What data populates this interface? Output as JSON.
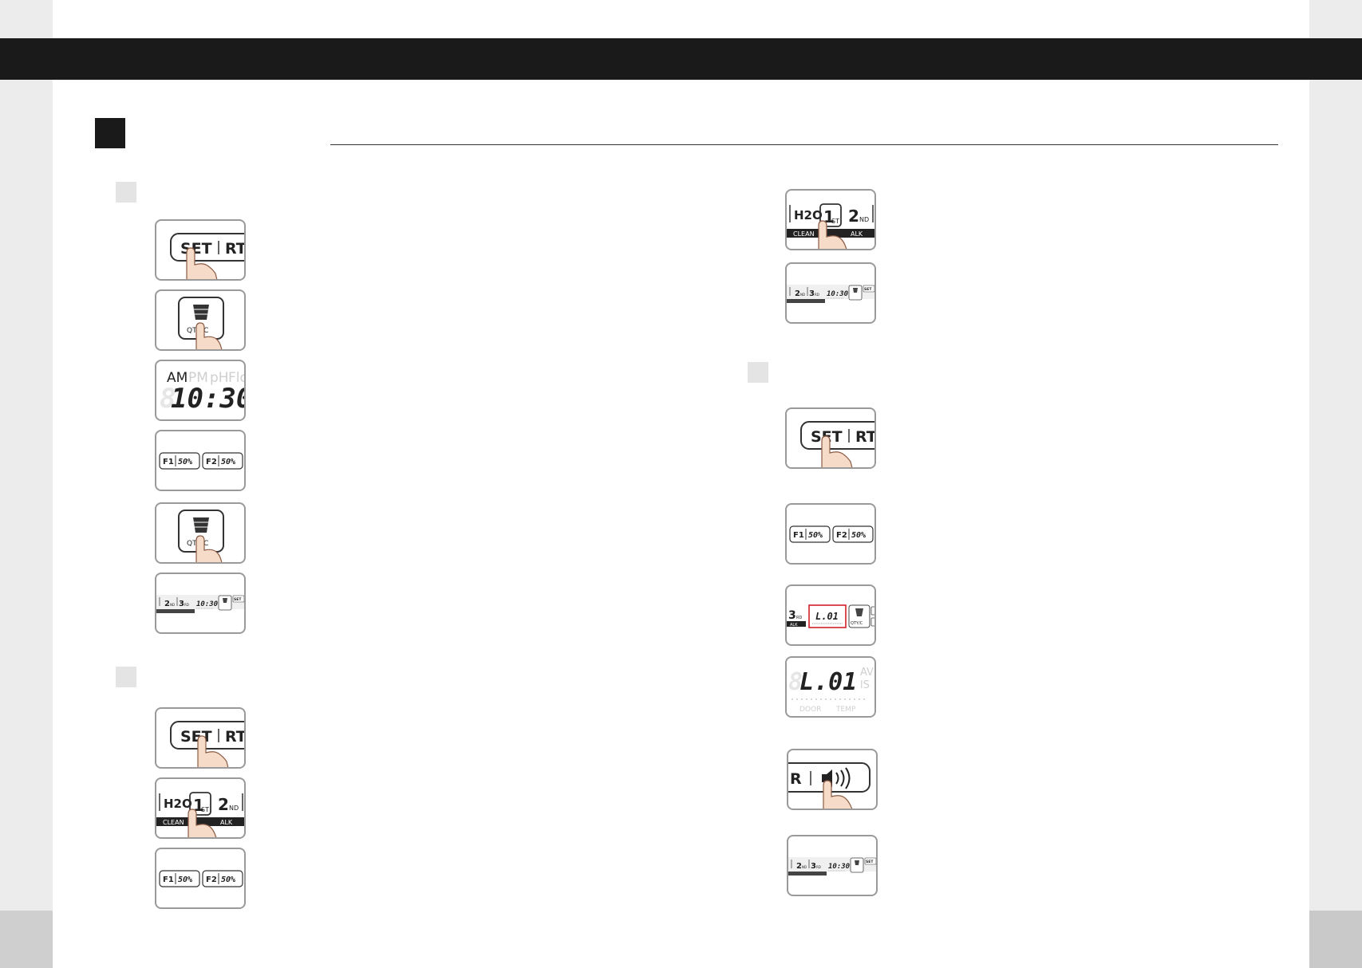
{
  "labels": {
    "set": "SET",
    "rt": "RT",
    "r": "R",
    "qty": "QTY/C",
    "am": "AM",
    "pm": "PM",
    "ph": "pH",
    "flow": "Flow",
    "time": "10:30",
    "f1": "F1",
    "f2": "F2",
    "f1_value": "50%",
    "f2_value": "50%",
    "h2o": "H2O",
    "first": "1",
    "first_sub": "ST",
    "second": "2",
    "second_sub": "ND",
    "third": "3",
    "third_sub": "RD",
    "clean": "CLEAN",
    "alk": "ALK",
    "code": "L.01",
    "door": "DOOR",
    "temp": "TEMP"
  },
  "colors": {
    "topbar": "#1a1a1a",
    "panel_border": "#9a9a9a",
    "highlight": "#d21f2b",
    "finger_fill": "#f6dcc8",
    "finger_stroke": "#8a5a44"
  }
}
